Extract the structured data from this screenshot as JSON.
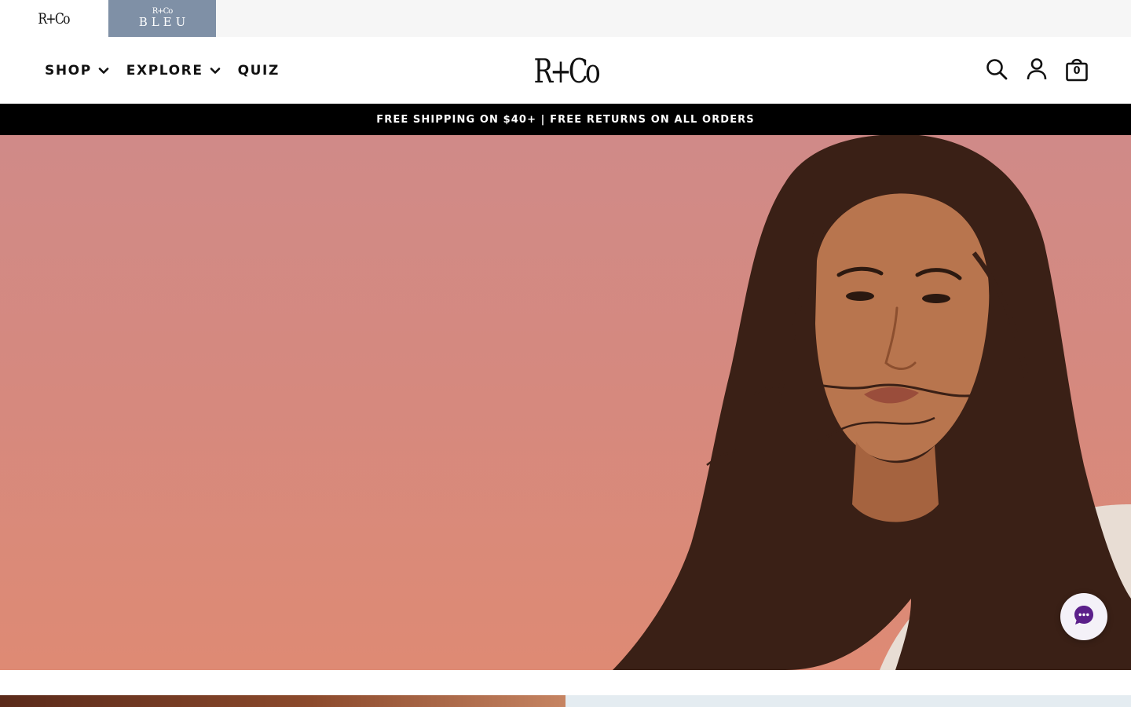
{
  "brand_bar": {
    "tabs": [
      {
        "label": "R+Co",
        "active": true
      },
      {
        "label_mark": "R+Co",
        "label_word": "BLEU",
        "active": false
      }
    ],
    "bleu_color": "#7f90a6"
  },
  "header": {
    "logo": "R+Co",
    "nav": [
      {
        "label": "SHOP",
        "has_dropdown": true,
        "icon": "chevron-down-icon"
      },
      {
        "label": "EXPLORE",
        "has_dropdown": true,
        "icon": "chevron-down-icon"
      },
      {
        "label": "QUIZ",
        "has_dropdown": false
      }
    ],
    "icons": [
      "search-icon",
      "account-icon",
      "bag-icon"
    ],
    "cart_count": "0"
  },
  "announcement": {
    "text": "FREE SHIPPING ON $40+ | FREE RETURNS ON ALL ORDERS"
  },
  "hero": {
    "background_color": "#d5897f",
    "image": "woman-with-long-curly-hair"
  },
  "chat": {
    "icon": "chat-bubble-icon",
    "accent": "#5b1f8a"
  }
}
